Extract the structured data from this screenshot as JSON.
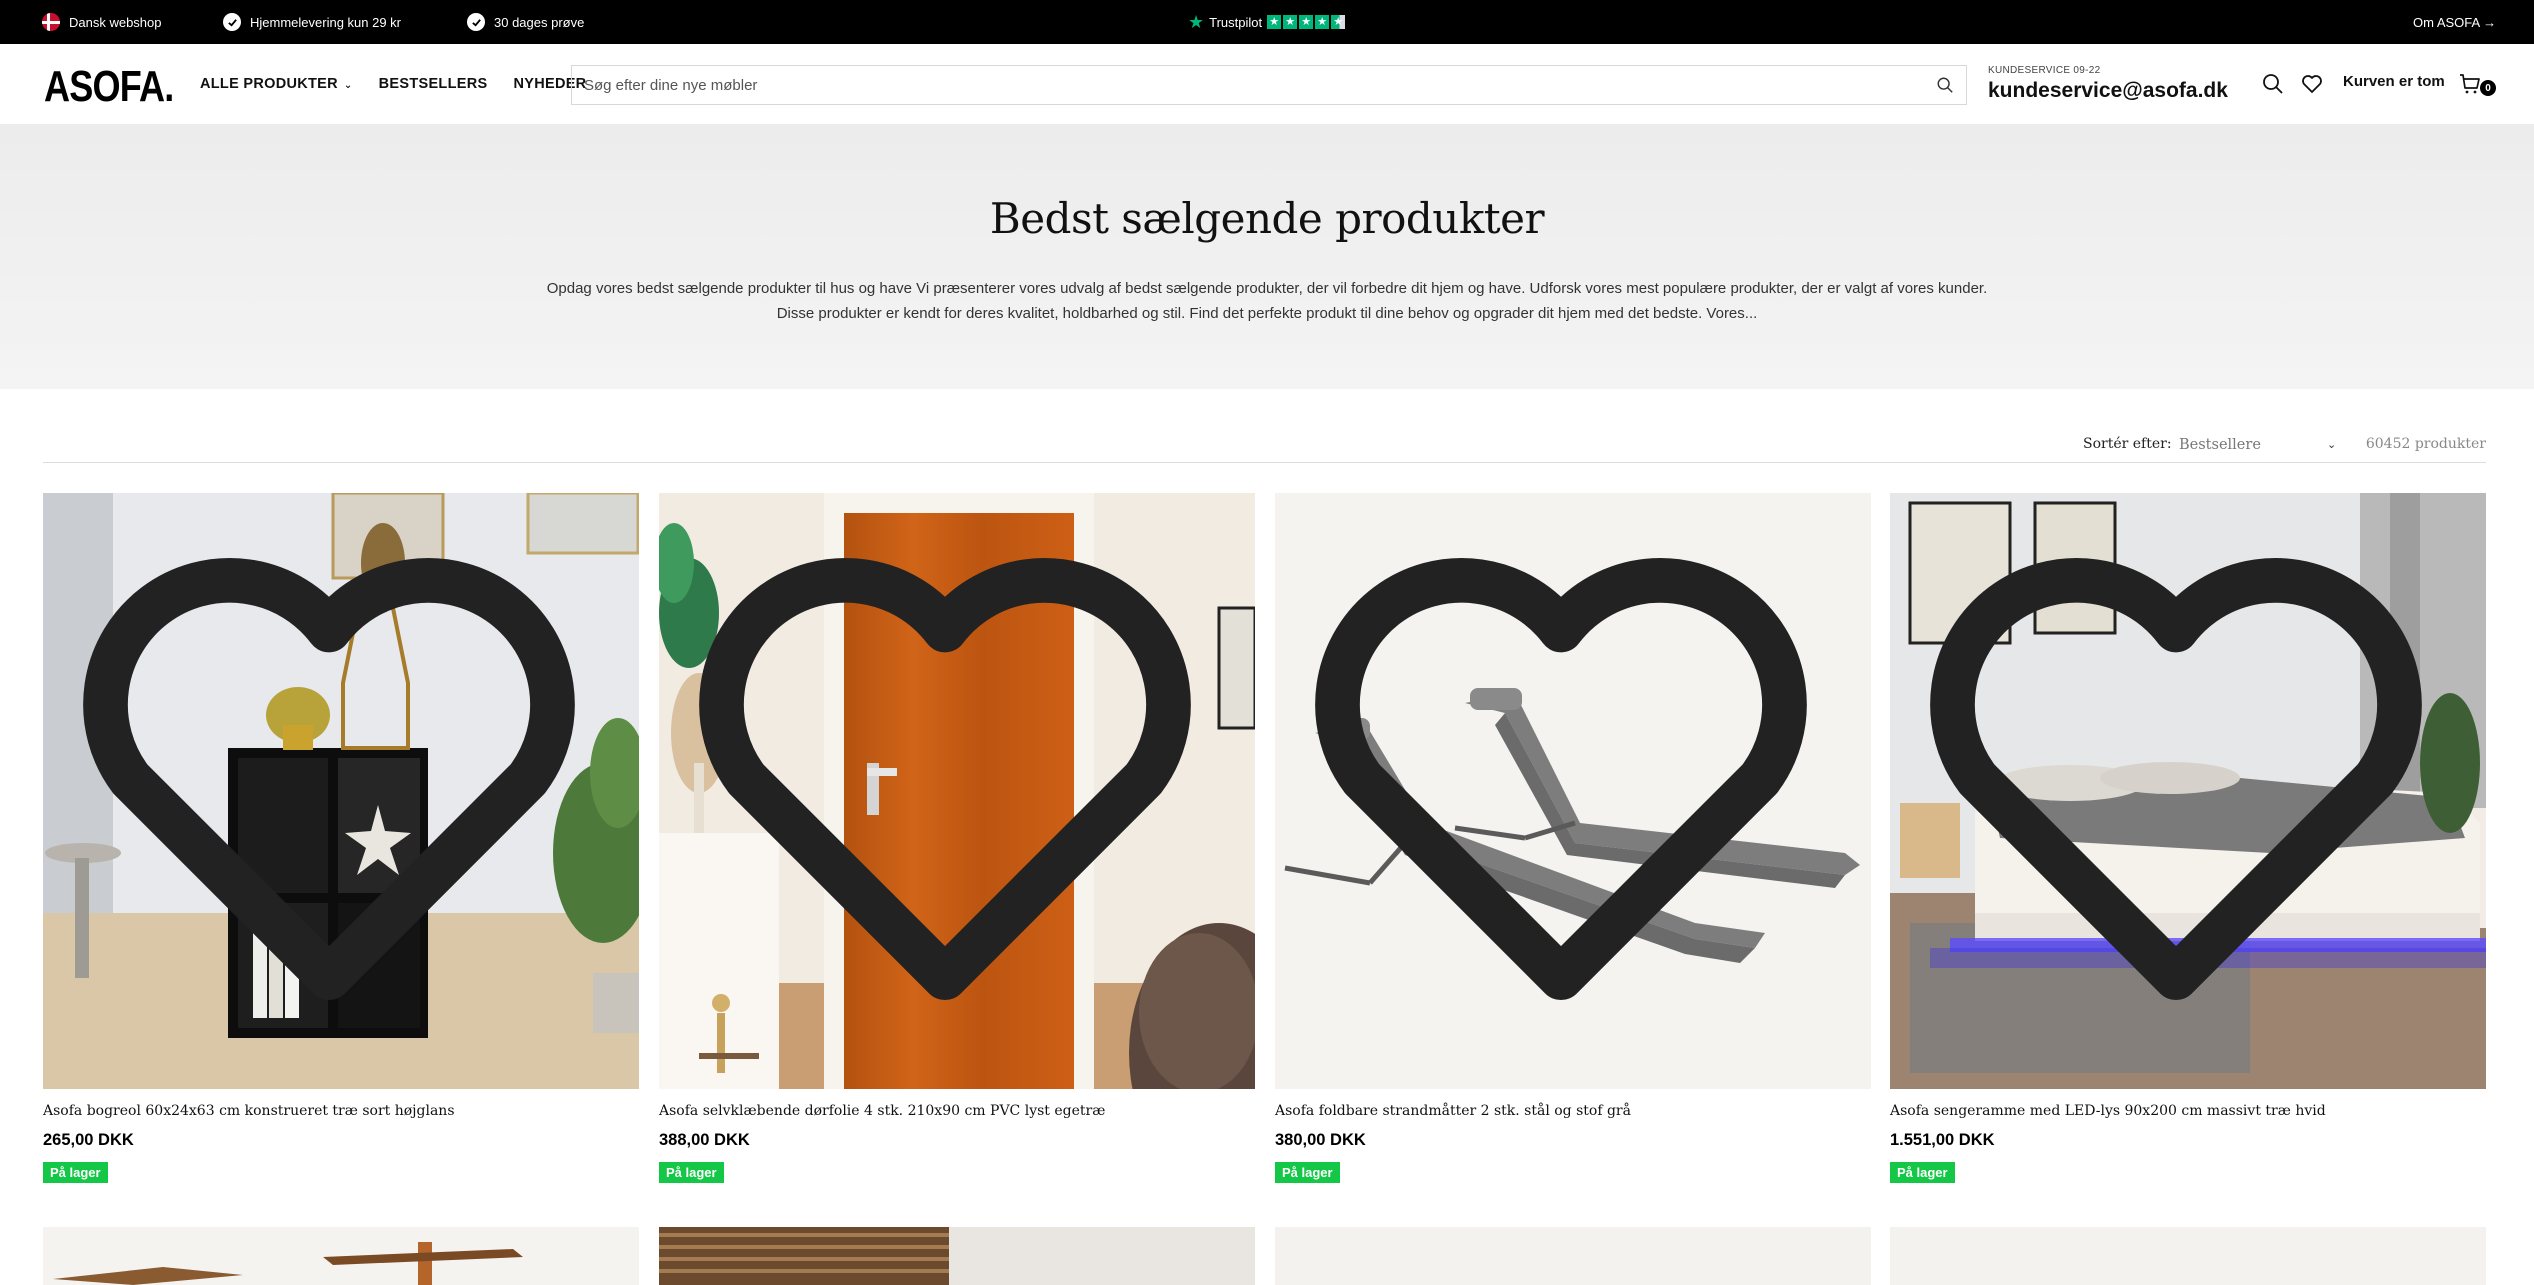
{
  "topbar": {
    "left_items": [
      "Dansk webshop",
      "Hjemmelevering kun 29 kr",
      "30 dages prøve"
    ],
    "trustpilot": "Trustpilot",
    "about_link": "Om ASOFA →"
  },
  "header": {
    "logo": "ASOFA.",
    "nav": [
      "ALLE PRODUKTER",
      "BESTSELLERS",
      "NYHEDER"
    ],
    "search_placeholder": "Søg efter dine nye møbler",
    "support_hours": "KUNDESERVICE 09-22",
    "support_email": "kundeservice@asofa.dk",
    "cart_label": "Kurven er tom",
    "cart_count": "0"
  },
  "hero": {
    "title": "Bedst sælgende produkter",
    "description": "Opdag vores bedst sælgende produkter til hus og have Vi præsenterer vores udvalg af bedst sælgende produkter, der vil forbedre dit hjem og have. Udforsk vores mest populære produkter, der er valgt af vores kunder. Disse produkter er kendt for deres kvalitet, holdbarhed og stil. Find det perfekte produkt til dine behov og opgrader dit hjem med det bedste. Vores..."
  },
  "toolbar": {
    "sort_label": "Sortér efter:",
    "sort_value": "Bestsellere",
    "product_count": "60452 produkter"
  },
  "products": [
    {
      "title": "Asofa bogreol 60x24x63 cm konstrueret træ sort højglans",
      "price": "265,00 DKK",
      "stock": "På lager",
      "icon": "bookshelf-image"
    },
    {
      "title": "Asofa selvklæbende dørfolie 4 stk. 210x90 cm PVC lyst egetræ",
      "price": "388,00 DKK",
      "stock": "På lager",
      "icon": "door-foil-image"
    },
    {
      "title": "Asofa foldbare strandmåtter 2 stk. stål og stof grå",
      "price": "380,00 DKK",
      "stock": "På lager",
      "icon": "beach-mats-image"
    },
    {
      "title": "Asofa sengeramme med LED-lys 90x200 cm massivt træ hvid",
      "price": "1.551,00 DKK",
      "stock": "På lager",
      "icon": "bed-frame-image"
    }
  ],
  "colors": {
    "accent_green": "#15c746",
    "trustpilot_green": "#00b67a",
    "topbar": "#000000"
  }
}
